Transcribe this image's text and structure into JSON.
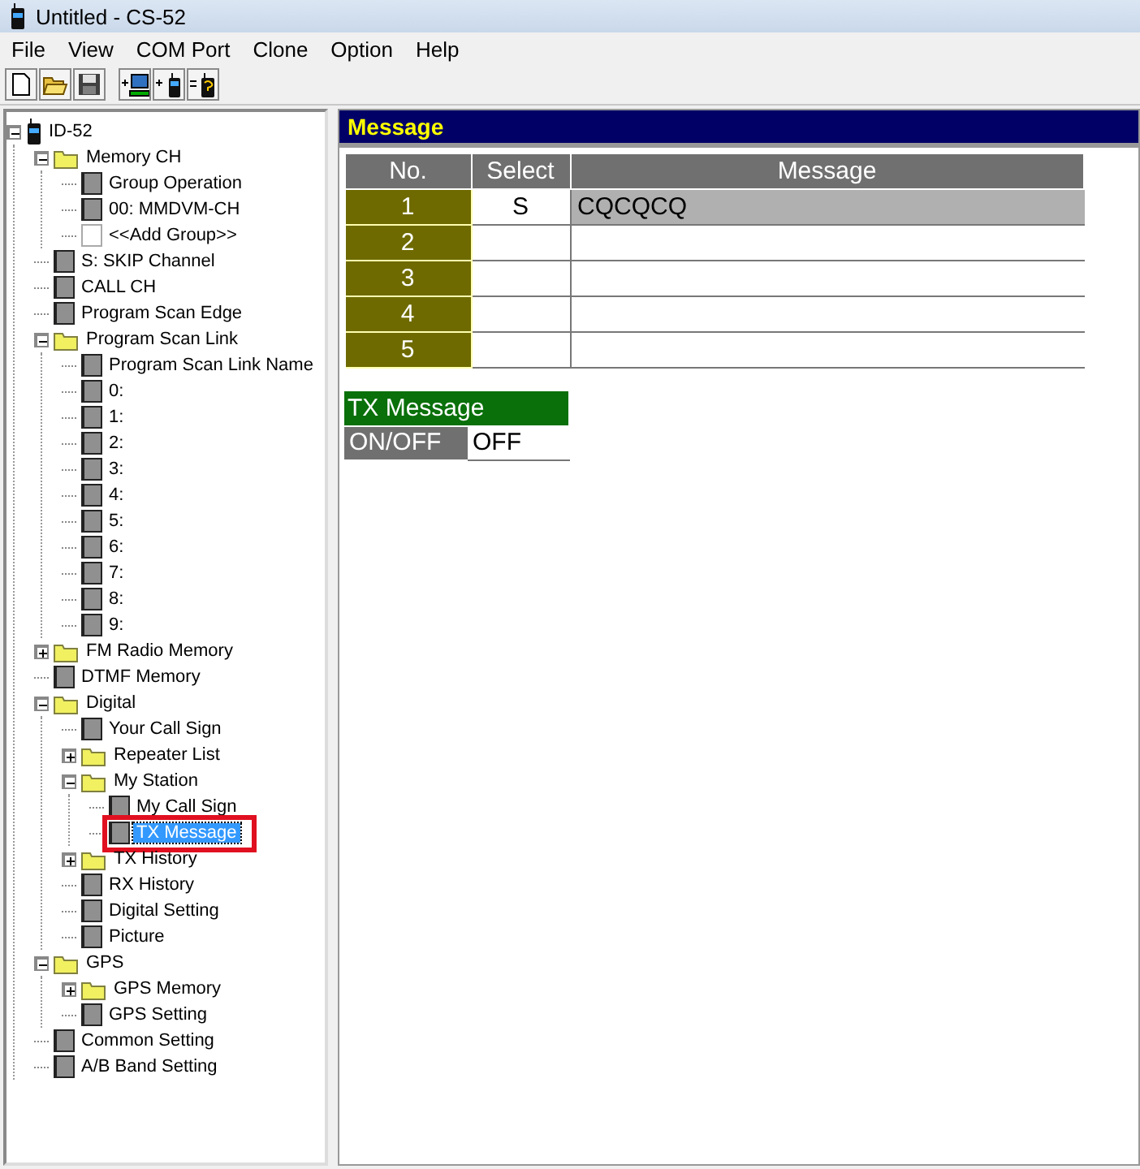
{
  "window": {
    "title": "Untitled - CS-52"
  },
  "menu": [
    "File",
    "View",
    "COM Port",
    "Clone",
    "Option",
    "Help"
  ],
  "toolbar": [
    {
      "kind": "new"
    },
    {
      "kind": "open"
    },
    {
      "kind": "save"
    },
    {
      "kind": "to-pc"
    },
    {
      "kind": "to-radio"
    },
    {
      "kind": "compare"
    }
  ],
  "tree": [
    {
      "label": "ID-52",
      "kind": "radio",
      "expanded": true,
      "selected": false,
      "children": [
        {
          "label": "Memory CH",
          "kind": "folder",
          "expanded": true,
          "selected": false,
          "children": [
            {
              "label": "Group Operation",
              "kind": "item",
              "selected": false
            },
            {
              "label": "00: MMDVM-CH",
              "kind": "item",
              "selected": false
            },
            {
              "label": "<<Add Group>>",
              "kind": "blank",
              "selected": false
            }
          ]
        },
        {
          "label": "S: SKIP Channel",
          "kind": "item",
          "selected": false
        },
        {
          "label": "CALL CH",
          "kind": "item",
          "selected": false
        },
        {
          "label": "Program Scan Edge",
          "kind": "item",
          "selected": false
        },
        {
          "label": "Program Scan Link",
          "kind": "folder",
          "expanded": true,
          "selected": false,
          "children": [
            {
              "label": "Program Scan Link Name",
              "kind": "item",
              "selected": false
            },
            {
              "label": "0:",
              "kind": "item",
              "selected": false
            },
            {
              "label": "1:",
              "kind": "item",
              "selected": false
            },
            {
              "label": "2:",
              "kind": "item",
              "selected": false
            },
            {
              "label": "3:",
              "kind": "item",
              "selected": false
            },
            {
              "label": "4:",
              "kind": "item",
              "selected": false
            },
            {
              "label": "5:",
              "kind": "item",
              "selected": false
            },
            {
              "label": "6:",
              "kind": "item",
              "selected": false
            },
            {
              "label": "7:",
              "kind": "item",
              "selected": false
            },
            {
              "label": "8:",
              "kind": "item",
              "selected": false
            },
            {
              "label": "9:",
              "kind": "item",
              "selected": false
            }
          ]
        },
        {
          "label": "FM Radio Memory",
          "kind": "folder",
          "expanded": false,
          "selected": false
        },
        {
          "label": "DTMF Memory",
          "kind": "item",
          "selected": false
        },
        {
          "label": "Digital",
          "kind": "folder",
          "expanded": true,
          "selected": false,
          "children": [
            {
              "label": "Your Call Sign",
              "kind": "item",
              "selected": false
            },
            {
              "label": "Repeater List",
              "kind": "folder",
              "expanded": false,
              "selected": false
            },
            {
              "label": "My Station",
              "kind": "folder",
              "expanded": true,
              "selected": false,
              "children": [
                {
                  "label": "My Call Sign",
                  "kind": "item",
                  "selected": false
                },
                {
                  "label": "TX Message",
                  "kind": "item",
                  "selected": true
                }
              ]
            },
            {
              "label": "TX History",
              "kind": "folder",
              "expanded": false,
              "selected": false
            },
            {
              "label": "RX History",
              "kind": "item",
              "selected": false
            },
            {
              "label": "Digital Setting",
              "kind": "item",
              "selected": false
            },
            {
              "label": "Picture",
              "kind": "item",
              "selected": false
            }
          ]
        },
        {
          "label": "GPS",
          "kind": "folder",
          "expanded": true,
          "selected": false,
          "children": [
            {
              "label": "GPS Memory",
              "kind": "folder",
              "expanded": false,
              "selected": false
            },
            {
              "label": "GPS Setting",
              "kind": "item",
              "selected": false
            }
          ]
        },
        {
          "label": "Common Setting",
          "kind": "item",
          "selected": false
        },
        {
          "label": "A/B Band Setting",
          "kind": "item",
          "selected": false
        }
      ]
    }
  ],
  "panel": {
    "title": "Message",
    "table": {
      "columns": [
        "No.",
        "Select",
        "Message"
      ],
      "rows": [
        {
          "no": "1",
          "select": "S",
          "message": "CQCQCQ",
          "selected": true
        },
        {
          "no": "2",
          "selected": false
        },
        {
          "no": "3",
          "selected": false
        },
        {
          "no": "4",
          "selected": false
        },
        {
          "no": "5",
          "selected": false
        }
      ]
    },
    "tx_message": {
      "title": "TX Message",
      "label": "ON/OFF",
      "value": "OFF"
    }
  }
}
